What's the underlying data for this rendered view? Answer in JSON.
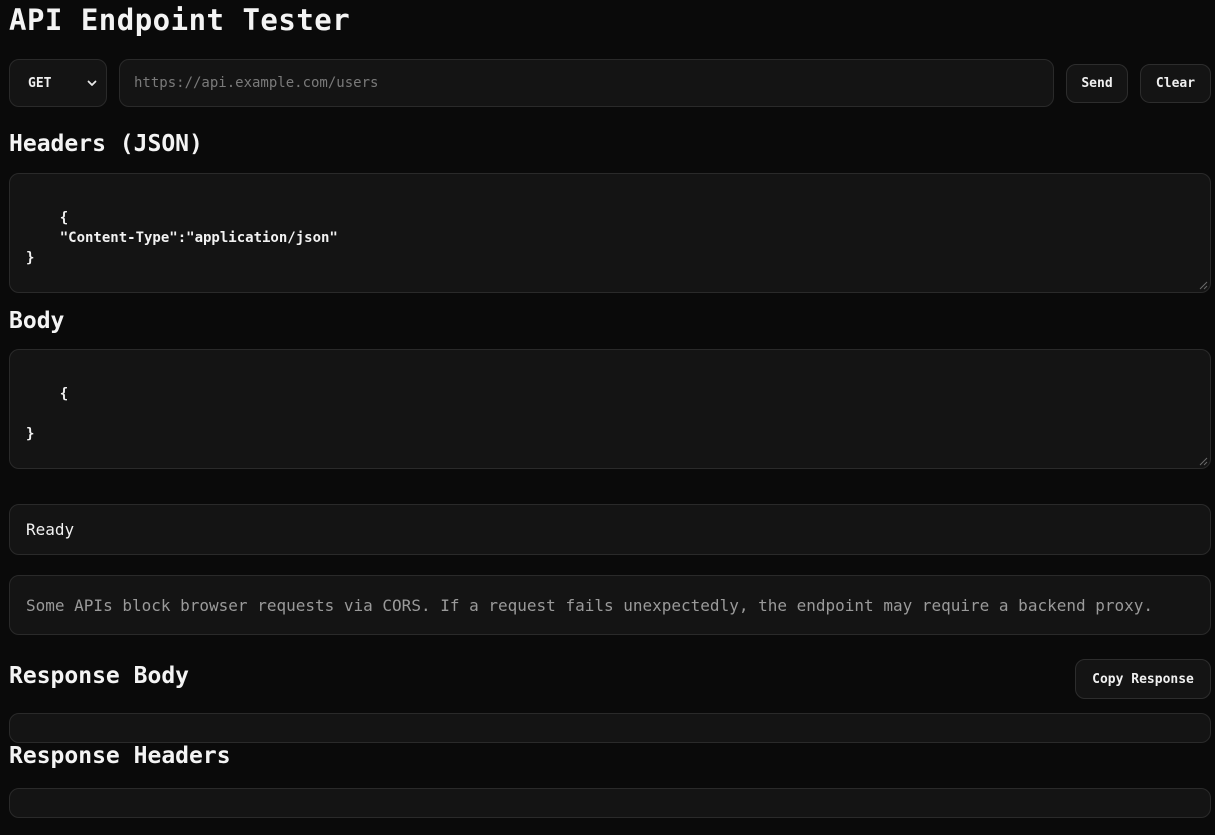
{
  "title": "API Endpoint Tester",
  "request": {
    "method": "GET",
    "url_placeholder": "https://api.example.com/users",
    "url_value": "",
    "send_label": "Send",
    "clear_label": "Clear"
  },
  "headers_section": {
    "heading": "Headers (JSON)",
    "value": "{\n    \"Content-Type\":\"application/json\"\n}"
  },
  "body_section": {
    "heading": "Body",
    "value": "{\n\n}"
  },
  "status": {
    "text": "Ready"
  },
  "cors_note": {
    "text": "Some APIs block browser requests via CORS. If a request fails unexpectedly, the endpoint may require a backend proxy."
  },
  "response_body": {
    "heading": "Response Body",
    "copy_label": "Copy Response",
    "value": ""
  },
  "response_headers": {
    "heading": "Response Headers",
    "value": ""
  },
  "icons": {
    "method_dropdown": "chevron-down-icon",
    "textarea_resize": "resize-grip-icon"
  },
  "colors": {
    "background": "#0a0a0a",
    "panel": "#141414",
    "border": "#2a2a2a",
    "text": "#f2f2f2",
    "muted_text": "#9a9a9a"
  }
}
